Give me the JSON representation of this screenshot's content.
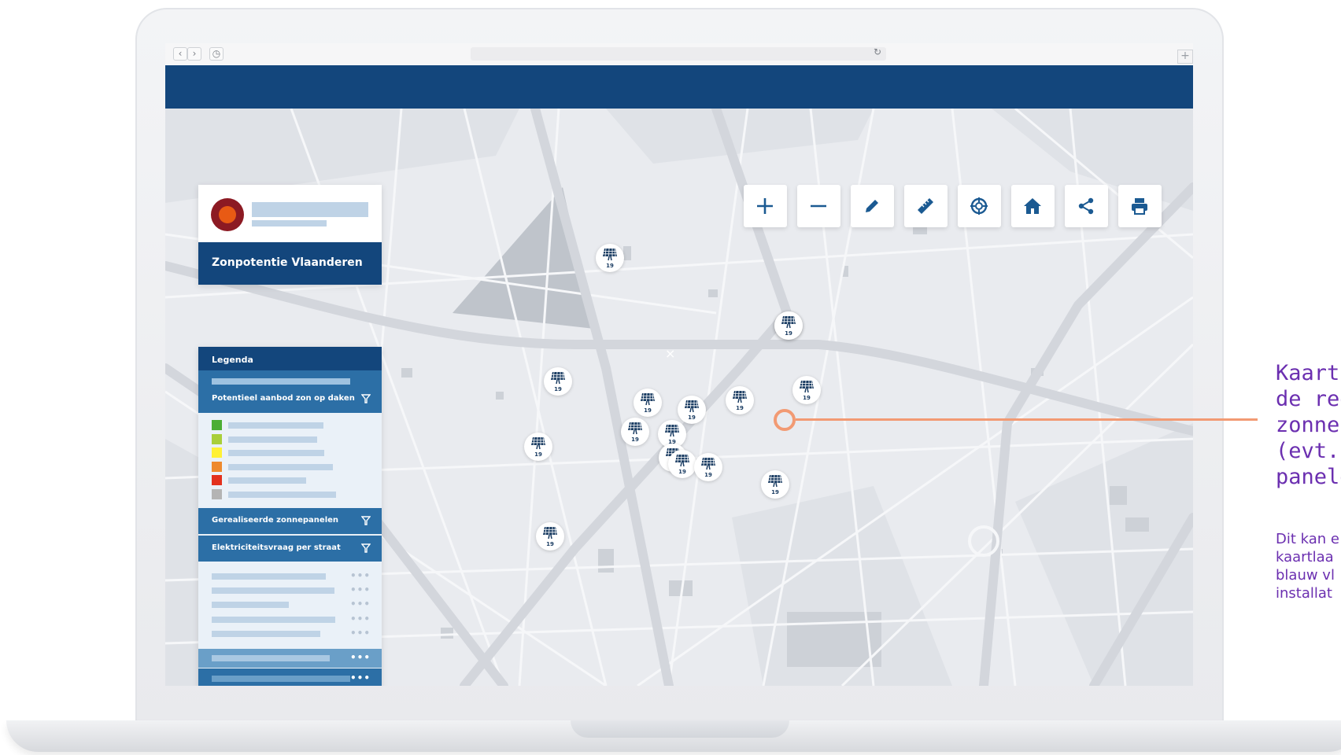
{
  "browser": {
    "back_icon": "chevron-left-icon",
    "forward_icon": "chevron-right-icon",
    "history_icon": "clock-icon",
    "reload_icon": "reload-icon",
    "newtab_icon": "plus-icon"
  },
  "app": {
    "title": "Zonpotentie Vlaanderen",
    "header_color": "#13467c",
    "accent_color": "#2c6fa6",
    "logo_colors": [
      "#8c1a23",
      "#e85a14"
    ]
  },
  "legend": {
    "title": "Legenda",
    "sections": [
      {
        "label": "Potentieel aanbod zon op daken",
        "swatches": [
          "#4cae34",
          "#a9cf3a",
          "#fff135",
          "#ee8a2e",
          "#e3311d",
          "#b4b4b4"
        ]
      },
      {
        "label": "Gerealiseerde zonnepanelen"
      },
      {
        "label": "Elektriciteitsvraag per straat"
      }
    ],
    "more_symbol": "•••"
  },
  "toolbar": {
    "tools": [
      {
        "name": "zoom-in",
        "icon": "plus-icon"
      },
      {
        "name": "zoom-out",
        "icon": "minus-icon"
      },
      {
        "name": "draw",
        "icon": "pencil-icon"
      },
      {
        "name": "measure",
        "icon": "ruler-icon"
      },
      {
        "name": "locate",
        "icon": "crosshair-icon"
      },
      {
        "name": "home",
        "icon": "home-icon"
      },
      {
        "name": "share",
        "icon": "share-icon"
      },
      {
        "name": "print",
        "icon": "print-icon"
      }
    ]
  },
  "map": {
    "marker_icon": "solar-panel-icon",
    "marker_label": "19",
    "marker_count": 16,
    "highlight_color": "#f29a73"
  },
  "annotation": {
    "title": "Kaartl\nde ree\nzonne\n(evt. i\npanele",
    "body": "Dit kan e\nkaartlaa\nblauw vl\ninstallat",
    "color": "#6b2fb0"
  }
}
